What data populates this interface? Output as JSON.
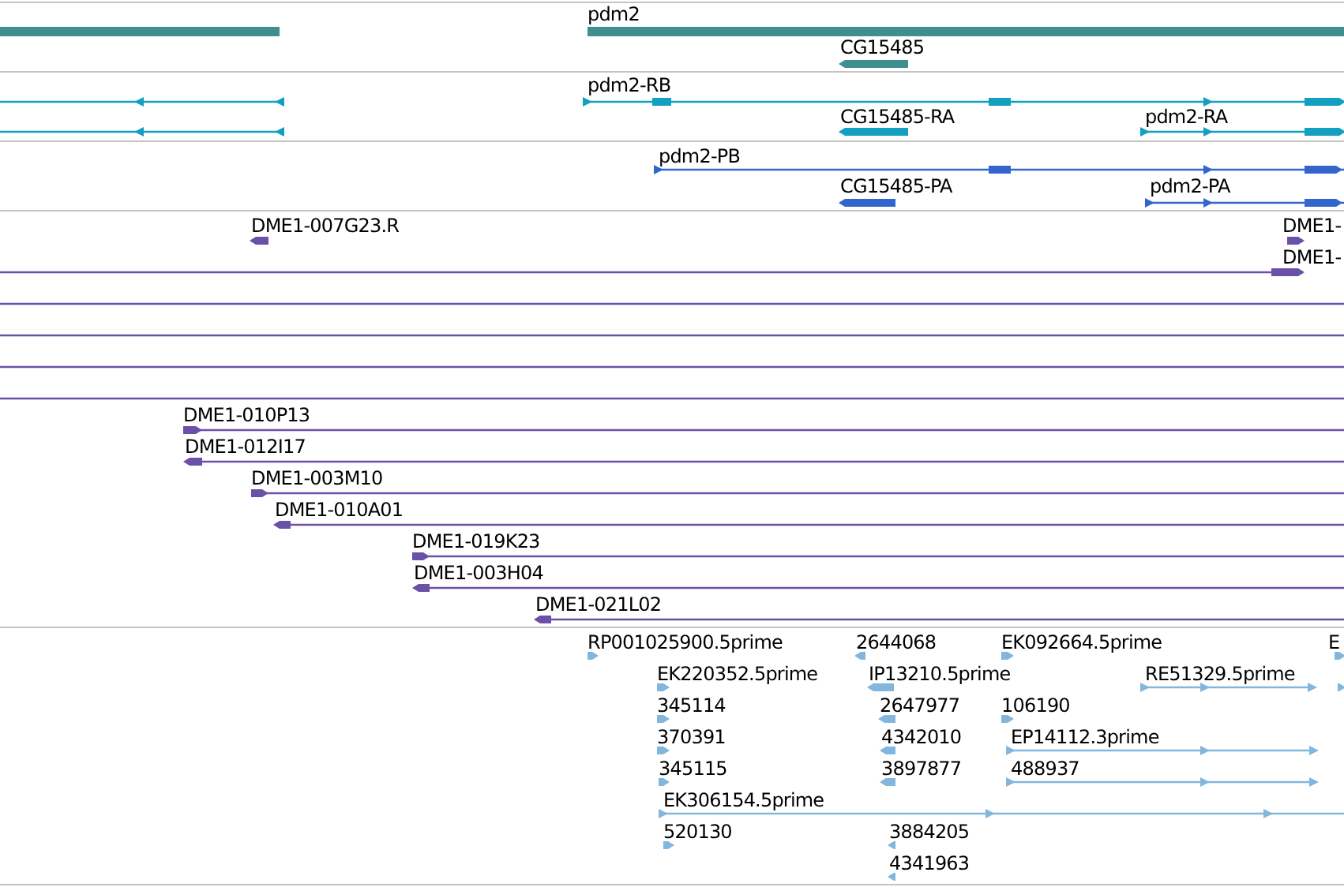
{
  "tracks": [
    {
      "kind": "genes",
      "features": [
        {
          "kind": "plain"
        },
        {
          "kind": "plain",
          "label": "pdm2"
        },
        {
          "kind": "directed",
          "label": "CG15485",
          "forward": false
        }
      ]
    },
    {
      "kind": "transcripts",
      "features": [
        {
          "kind": "directed",
          "forward": false
        },
        {
          "kind": "directed",
          "label": "pdm2-RB",
          "forward": true
        },
        {
          "kind": "directed",
          "forward": false
        },
        {
          "kind": "directed",
          "label": "CG15485-RA",
          "forward": false
        },
        {
          "kind": "directed",
          "label": "pdm2-RA",
          "forward": true
        }
      ]
    },
    {
      "kind": "proteins",
      "features": [
        {
          "kind": "directed",
          "label": "pdm2-PB",
          "forward": true
        },
        {
          "kind": "directed",
          "label": "CG15485-PA",
          "forward": false
        },
        {
          "kind": "directed",
          "label": "pdm2-PA",
          "forward": true
        }
      ]
    },
    {
      "kind": "clones",
      "features": [
        {
          "kind": "directed",
          "label": "DME1-007G23.R",
          "forward": false
        },
        {
          "kind": "directed",
          "label": "DME1-",
          "forward": true
        },
        {
          "kind": "directed",
          "label": "DME1-",
          "forward": true
        },
        {
          "kind": "plain"
        },
        {
          "kind": "plain"
        },
        {
          "kind": "plain"
        },
        {
          "kind": "plain"
        },
        {
          "kind": "directed",
          "label": "DME1-010P13",
          "forward": true
        },
        {
          "kind": "directed",
          "label": "DME1-012I17",
          "forward": false
        },
        {
          "kind": "directed",
          "label": "DME1-003M10",
          "forward": true
        },
        {
          "kind": "directed",
          "label": "DME1-010A01",
          "forward": false
        },
        {
          "kind": "directed",
          "label": "DME1-019K23",
          "forward": true
        },
        {
          "kind": "directed",
          "label": "DME1-003H04",
          "forward": false
        },
        {
          "kind": "directed",
          "label": "DME1-021L02",
          "forward": false
        }
      ]
    },
    {
      "kind": "ests",
      "features": [
        {
          "kind": "directed",
          "label": "RP001025900.5prime",
          "forward": true
        },
        {
          "kind": "directed",
          "label": "2644068",
          "forward": false
        },
        {
          "kind": "directed",
          "label": "EK092664.5prime",
          "forward": true
        },
        {
          "kind": "directed",
          "label": "E",
          "forward": true
        },
        {
          "kind": "directed",
          "label": "EK220352.5prime",
          "forward": true
        },
        {
          "kind": "directed",
          "label": "IP13210.5prime",
          "forward": false
        },
        {
          "kind": "directed",
          "label": "RE51329.5prime",
          "forward": true
        },
        {
          "kind": "directed",
          "forward": true
        },
        {
          "kind": "directed",
          "label": "345114",
          "forward": true
        },
        {
          "kind": "directed",
          "label": "2647977",
          "forward": false
        },
        {
          "kind": "directed",
          "label": "106190",
          "forward": true
        },
        {
          "kind": "directed",
          "label": "370391",
          "forward": true
        },
        {
          "kind": "directed",
          "label": "4342010",
          "forward": false
        },
        {
          "kind": "directed",
          "label": "EP14112.3prime",
          "forward": true
        },
        {
          "kind": "directed",
          "label": "345115",
          "forward": true
        },
        {
          "kind": "directed",
          "label": "3897877",
          "forward": false
        },
        {
          "kind": "directed",
          "label": "488937",
          "forward": true
        },
        {
          "kind": "directed",
          "label": "EK306154.5prime",
          "forward": true
        },
        {
          "kind": "directed",
          "label": "520130",
          "forward": true
        },
        {
          "kind": "directed",
          "label": "3884205",
          "forward": false
        },
        {
          "kind": "directed",
          "label": "4341963",
          "forward": false
        }
      ]
    }
  ]
}
